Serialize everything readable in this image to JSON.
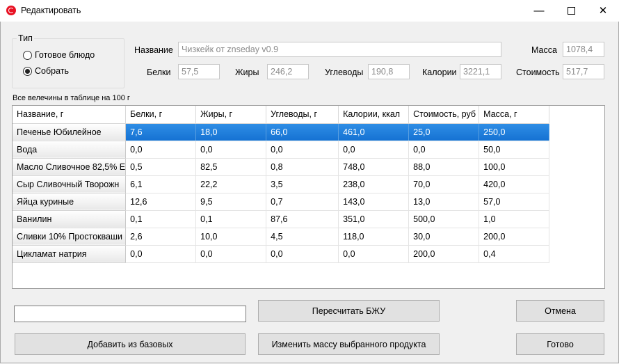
{
  "window": {
    "title": "Редактировать",
    "controls": {
      "minimize": "—",
      "close": "✕"
    }
  },
  "type_group": {
    "label": "Тип",
    "options": [
      {
        "label": "Готовое блюдо",
        "selected": false
      },
      {
        "label": "Собрать",
        "selected": true
      }
    ]
  },
  "form": {
    "name_label": "Название",
    "name_value": "Чизкейк от znseday v0.9",
    "mass_label": "Масса",
    "mass_value": "1078,4",
    "protein_label": "Белки",
    "protein_value": "57,5",
    "fat_label": "Жиры",
    "fat_value": "246,2",
    "carbs_label": "Углеводы",
    "carbs_value": "190,8",
    "calories_label": "Калории",
    "calories_value": "3221,1",
    "cost_label": "Стоимость",
    "cost_value": "517,7"
  },
  "table_note": "Все велечины в таблице на 100 г",
  "table": {
    "columns": [
      "Название, г",
      "Белки, г",
      "Жиры, г",
      "Углеводы, г",
      "Калории, ккал",
      "Стоимость, руб",
      "Масса, г"
    ],
    "selected_row": 0,
    "rows": [
      [
        "Печенье Юбилейное",
        "7,6",
        "18,0",
        "66,0",
        "461,0",
        "25,0",
        "250,0"
      ],
      [
        "Вода",
        "0,0",
        "0,0",
        "0,0",
        "0,0",
        "0,0",
        "50,0"
      ],
      [
        "Масло Сливочное 82,5% Е",
        "0,5",
        "82,5",
        "0,8",
        "748,0",
        "88,0",
        "100,0"
      ],
      [
        "Сыр Сливочный Творожн",
        "6,1",
        "22,2",
        "3,5",
        "238,0",
        "70,0",
        "420,0"
      ],
      [
        "Яйца куриные",
        "12,6",
        "9,5",
        "0,7",
        "143,0",
        "13,0",
        "57,0"
      ],
      [
        "Ванилин",
        "0,1",
        "0,1",
        "87,6",
        "351,0",
        "500,0",
        "1,0"
      ],
      [
        "Сливки 10% Простокваши",
        "2,6",
        "10,0",
        "4,5",
        "118,0",
        "30,0",
        "200,0"
      ],
      [
        "Цикламат натрия",
        "0,0",
        "0,0",
        "0,0",
        "0,0",
        "200,0",
        "0,4"
      ]
    ]
  },
  "bottom": {
    "search_value": "",
    "recalc_label": "Пересчитать БЖУ",
    "cancel_label": "Отмена",
    "add_label": "Добавить из базовых",
    "change_mass_label": "Изменить массу выбранного продукта",
    "done_label": "Готово"
  },
  "colors": {
    "selection": "#1a76d6",
    "close_icon": "#e81123"
  }
}
